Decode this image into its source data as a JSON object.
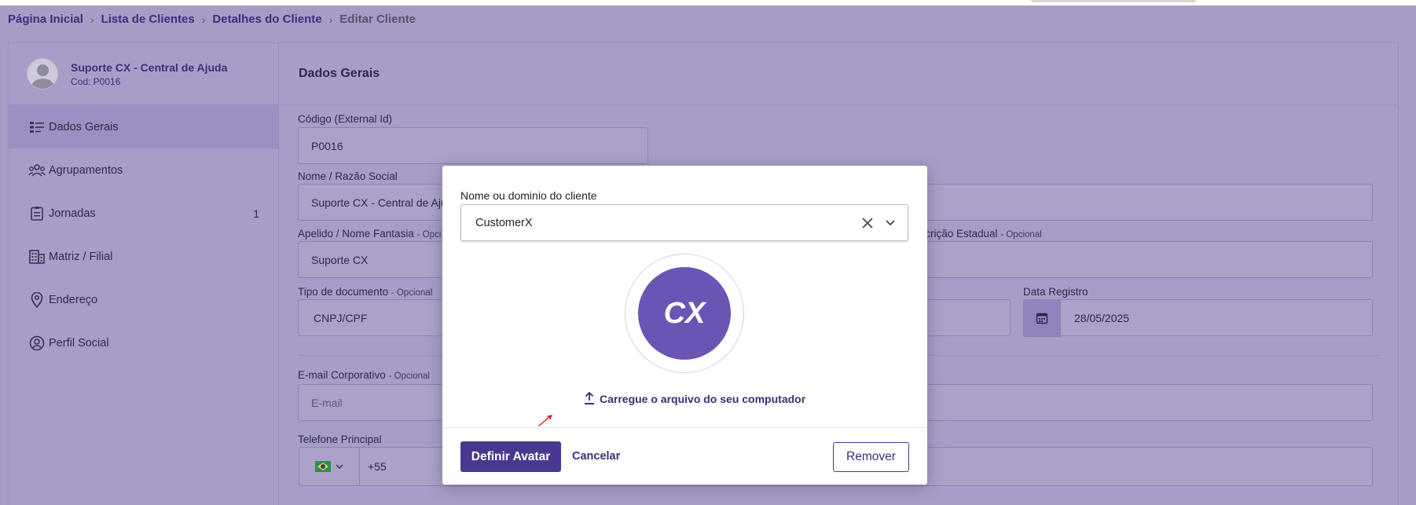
{
  "breadcrumb": {
    "items": [
      "Página Inicial",
      "Lista de Clientes",
      "Detalhes do Cliente"
    ],
    "current": "Editar Cliente",
    "separator": "›"
  },
  "profile": {
    "name": "Suporte CX - Central de Ajuda",
    "code": "Cod: P0016"
  },
  "sidebar": {
    "items": [
      {
        "label": "Dados Gerais",
        "icon": "list-icon",
        "active": true
      },
      {
        "label": "Agrupamentos",
        "icon": "group-icon"
      },
      {
        "label": "Jornadas",
        "icon": "clipboard-icon",
        "count": "1"
      },
      {
        "label": "Matriz / Filial",
        "icon": "building-icon"
      },
      {
        "label": "Endereço",
        "icon": "location-pin-icon"
      },
      {
        "label": "Perfil Social",
        "icon": "user-circle-icon"
      }
    ]
  },
  "main": {
    "title": "Dados Gerais",
    "code_label": "Código (External Id)",
    "code_value": "P0016",
    "name_label": "Nome / Razão Social",
    "name_value": "Suporte CX - Central de Aju",
    "nickname_label": "Apelido / Nome Fantasia",
    "nickname_opt": "- Opci",
    "nickname_value": "Suporte CX",
    "state_reg_label": "nscrição Estadual",
    "state_reg_opt": "- Opcional",
    "doc_type_label": "Tipo de documento",
    "doc_type_opt": "- Opcional",
    "doc_type_value": "CNPJ/CPF",
    "date_label": "Data Registro",
    "date_value": "28/05/2025",
    "email_label": "E-mail Corporativo",
    "email_opt": "- Opcional",
    "email_placeholder": "E-mail",
    "phone_label": "Telefone Principal",
    "phone_value": "+55"
  },
  "modal": {
    "field_label": "Nome ou dominio do cliente",
    "field_value": "CustomerX",
    "avatar_text": "CX",
    "upload_label": "Carregue o arquivo do seu computador",
    "primary_button": "Definir Avatar",
    "cancel_button": "Cancelar",
    "remove_button": "Remover"
  },
  "colors": {
    "accent": "#4a3890",
    "avatar_bg": "#6a55b5",
    "overlay": "#a79cc6"
  }
}
